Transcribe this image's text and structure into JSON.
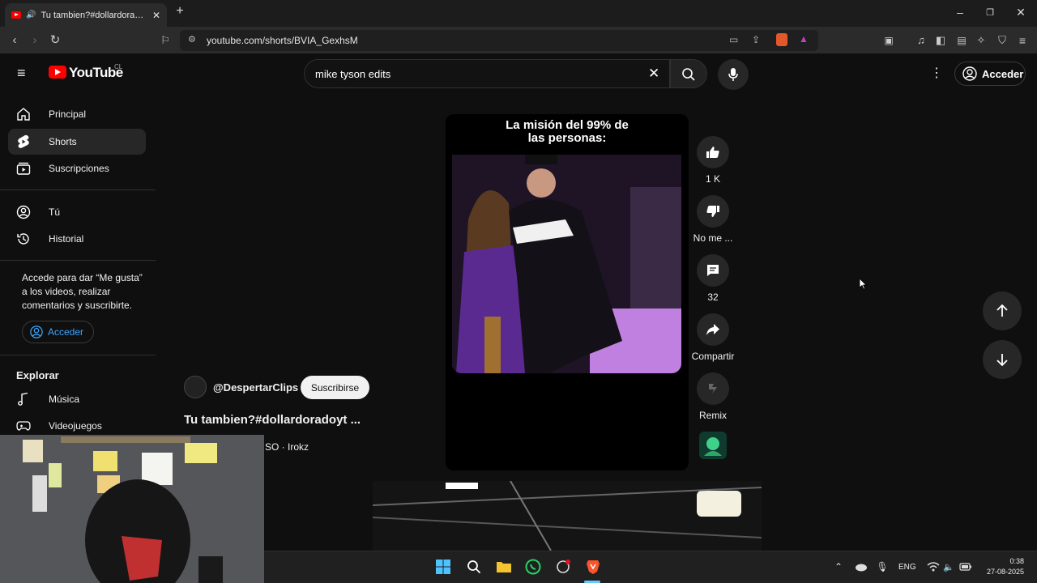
{
  "browser": {
    "tab_title": "Tu tambien?#dollardoradoyt",
    "url": "youtube.com/shorts/BVIA_GexhsM"
  },
  "header": {
    "logo_text": "YouTube",
    "region": "CL",
    "search_value": "mike tyson edits",
    "signin_label": "Acceder"
  },
  "sidebar": {
    "items": [
      {
        "label": "Principal",
        "icon": "home-icon"
      },
      {
        "label": "Shorts",
        "icon": "shorts-icon"
      },
      {
        "label": "Suscripciones",
        "icon": "subscriptions-icon"
      }
    ],
    "you_items": [
      {
        "label": "Tú",
        "icon": "user-icon"
      },
      {
        "label": "Historial",
        "icon": "history-icon"
      }
    ],
    "note": "Accede para dar “Me gusta” a los videos, realizar comentarios y suscribirte.",
    "signin_label": "Acceder",
    "explore_heading": "Explorar",
    "explore_items": [
      {
        "label": "Música",
        "icon": "music-icon"
      },
      {
        "label": "Videojuegos",
        "icon": "gamepad-icon"
      }
    ]
  },
  "short": {
    "overlay_line1": "La misión del 99% de",
    "overlay_line2": "las personas:",
    "channel": "@DespertarClips",
    "subscribe_label": "Suscribirse",
    "title": "Tu tambien?#dollardoradoyt ...",
    "music": "SO · Irokz"
  },
  "actions": {
    "likes": "1 K",
    "dislike": "No me ...",
    "comments": "32",
    "share": "Compartir",
    "remix": "Remix"
  },
  "taskbar": {
    "lang": "ENG",
    "time": "0:38",
    "date": "27-08-2025"
  },
  "colors": {
    "background": "#0f0f0f",
    "brand_red": "#ff0000",
    "link_blue": "#3ea6ff"
  }
}
